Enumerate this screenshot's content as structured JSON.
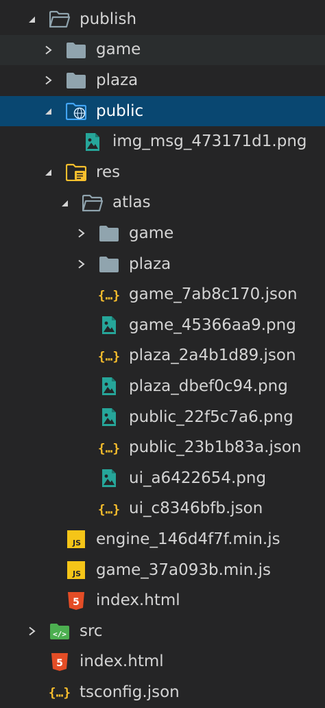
{
  "explorer": {
    "items": [
      {
        "label": "publish",
        "depth": 0,
        "twisty": "expanded",
        "icon": "folder-open-icon",
        "state": "normal"
      },
      {
        "label": "game",
        "depth": 1,
        "twisty": "collapsed",
        "icon": "folder-icon",
        "state": "hover"
      },
      {
        "label": "plaza",
        "depth": 1,
        "twisty": "collapsed",
        "icon": "folder-icon",
        "state": "normal"
      },
      {
        "label": "public",
        "depth": 1,
        "twisty": "expanded",
        "icon": "folder-public-icon",
        "state": "selected"
      },
      {
        "label": "img_msg_473171d1.png",
        "depth": 2,
        "twisty": "none",
        "icon": "image-file-icon",
        "state": "normal"
      },
      {
        "label": "res",
        "depth": 1,
        "twisty": "expanded",
        "icon": "folder-resource-icon",
        "state": "normal"
      },
      {
        "label": "atlas",
        "depth": 2,
        "twisty": "expanded",
        "icon": "folder-open-icon",
        "state": "normal"
      },
      {
        "label": "game",
        "depth": 3,
        "twisty": "collapsed",
        "icon": "folder-icon",
        "state": "normal"
      },
      {
        "label": "plaza",
        "depth": 3,
        "twisty": "collapsed",
        "icon": "folder-icon",
        "state": "normal"
      },
      {
        "label": "game_7ab8c170.json",
        "depth": 3,
        "twisty": "none",
        "icon": "json-file-icon",
        "state": "normal"
      },
      {
        "label": "game_45366aa9.png",
        "depth": 3,
        "twisty": "none",
        "icon": "image-file-icon",
        "state": "normal"
      },
      {
        "label": "plaza_2a4b1d89.json",
        "depth": 3,
        "twisty": "none",
        "icon": "json-file-icon",
        "state": "normal"
      },
      {
        "label": "plaza_dbef0c94.png",
        "depth": 3,
        "twisty": "none",
        "icon": "image-file-icon",
        "state": "normal"
      },
      {
        "label": "public_22f5c7a6.png",
        "depth": 3,
        "twisty": "none",
        "icon": "image-file-icon",
        "state": "normal"
      },
      {
        "label": "public_23b1b83a.json",
        "depth": 3,
        "twisty": "none",
        "icon": "json-file-icon",
        "state": "normal"
      },
      {
        "label": "ui_a6422654.png",
        "depth": 3,
        "twisty": "none",
        "icon": "image-file-icon",
        "state": "normal"
      },
      {
        "label": "ui_c8346bfb.json",
        "depth": 3,
        "twisty": "none",
        "icon": "json-file-icon",
        "state": "normal"
      },
      {
        "label": "engine_146d4f7f.min.js",
        "depth": 1,
        "twisty": "none",
        "icon": "js-file-icon",
        "state": "normal"
      },
      {
        "label": "game_37a093b.min.js",
        "depth": 1,
        "twisty": "none",
        "icon": "js-file-icon",
        "state": "normal"
      },
      {
        "label": "index.html",
        "depth": 1,
        "twisty": "none",
        "icon": "html-file-icon",
        "state": "normal"
      },
      {
        "label": "src",
        "depth": 0,
        "twisty": "collapsed",
        "icon": "folder-src-icon",
        "state": "normal"
      },
      {
        "label": "index.html",
        "depth": 0,
        "twisty": "none",
        "icon": "html-file-icon",
        "state": "normal"
      },
      {
        "label": "tsconfig.json",
        "depth": 0,
        "twisty": "none",
        "icon": "json-file-icon",
        "state": "normal"
      }
    ]
  },
  "colors": {
    "background": "#252526",
    "selected": "#094771",
    "hover": "#2a2d2e",
    "text": "#d4d4d4",
    "folder": "#90a4ae",
    "image_icon": "#26a69a",
    "json_icon": "#fbc02d",
    "js_icon": "#f5c518",
    "html_icon": "#e44d26",
    "public_folder": "#42a5f5",
    "res_folder": "#fbc02d",
    "src_folder": "#4caf50"
  }
}
